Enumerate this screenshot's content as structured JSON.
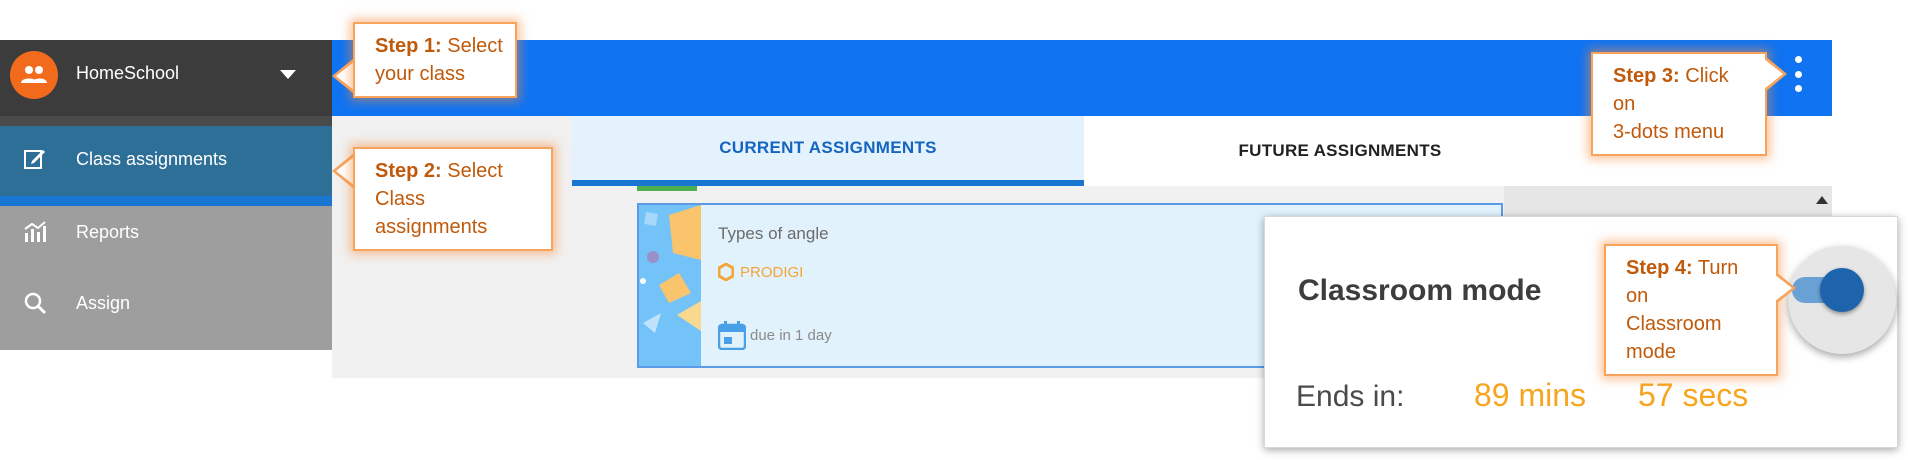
{
  "sidebar": {
    "class_name": "HomeSchool",
    "items": [
      {
        "label": "Class assignments",
        "icon": "edit-icon",
        "active": true
      },
      {
        "label": "Reports",
        "icon": "chart-icon",
        "active": false
      },
      {
        "label": "Assign",
        "icon": "search-icon",
        "active": false
      }
    ]
  },
  "tabs": [
    {
      "label": "CURRENT ASSIGNMENTS",
      "active": true
    },
    {
      "label": "FUTURE ASSIGNMENTS",
      "active": false
    }
  ],
  "assignment": {
    "title": "Types of angle",
    "publisher": "PRODIGI",
    "due": "due in 1 day"
  },
  "classroom_mode": {
    "title": "Classroom mode",
    "ends_label": "Ends in:",
    "mins": "89 mins",
    "secs": "57 secs",
    "enabled": true
  },
  "callouts": [
    {
      "step": "Step 1:",
      "line1": "Select",
      "line2": "your class"
    },
    {
      "step": "Step 2:",
      "line1": "Select",
      "line2": "Class assignments"
    },
    {
      "step": "Step 3:",
      "line1": "Click on",
      "line2": "3-dots menu"
    },
    {
      "step": "Step 4:",
      "line1": "Turn on",
      "line2": "Classroom mode"
    }
  ],
  "colors": {
    "appbar": "#0f73f2",
    "accent_orange": "#f26b1d",
    "timer": "#f7a520",
    "callout_border": "#f7a35c"
  }
}
